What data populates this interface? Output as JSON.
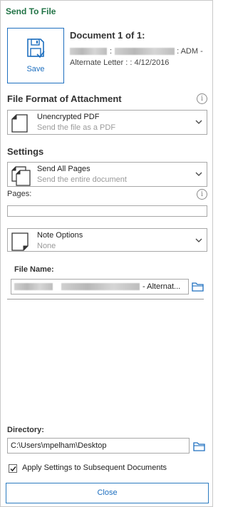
{
  "pane": {
    "title": "Send To File"
  },
  "save_button": {
    "label": "Save"
  },
  "document": {
    "heading": "Document 1 of 1:",
    "line1_suffix": ": ADM -",
    "line1_sep": ":",
    "line2": "Alternate Letter : : 4/12/2016"
  },
  "file_format": {
    "heading": "File Format of Attachment",
    "selected_title": "Unencrypted PDF",
    "selected_desc": "Send the file as a PDF"
  },
  "settings": {
    "heading": "Settings",
    "pages_option_title": "Send All Pages",
    "pages_option_desc": "Send the entire document",
    "pages_label": "Pages:",
    "pages_value": "",
    "note_option_title": "Note Options",
    "note_option_desc": "None"
  },
  "file_name": {
    "label": "File Name:",
    "value_suffix": "- Alternat..."
  },
  "directory": {
    "label": "Directory:",
    "value": "C:\\Users\\mpelham\\Desktop"
  },
  "apply_settings": {
    "label": "Apply Settings to Subsequent Documents",
    "checked": true
  },
  "close_button": {
    "label": "Close"
  },
  "colors": {
    "accent": "#1e6fbf",
    "title_green": "#217346"
  }
}
